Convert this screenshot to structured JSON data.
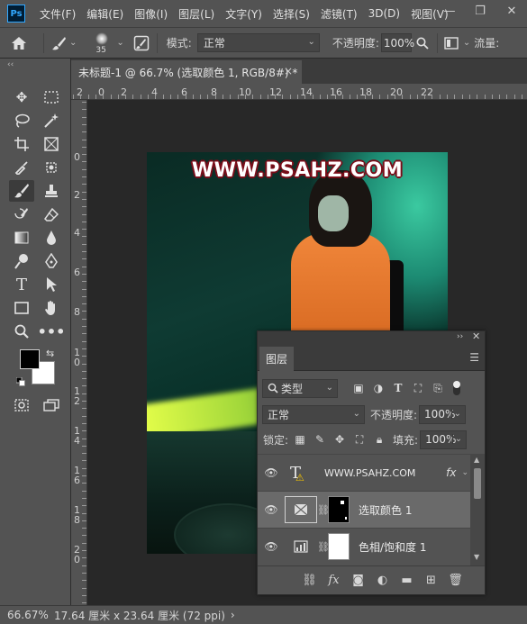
{
  "app": {
    "logo": "Ps"
  },
  "menu": [
    "文件(F)",
    "编辑(E)",
    "图像(I)",
    "图层(L)",
    "文字(Y)",
    "选择(S)",
    "滤镜(T)",
    "3D(D)",
    "视图(V)"
  ],
  "window_controls": {
    "minimize": "—",
    "restore": "❐",
    "close": "✕"
  },
  "options": {
    "brush_size": "35",
    "mode_label": "模式:",
    "mode_value": "正常",
    "opacity_label": "不透明度:",
    "opacity_value": "100%",
    "flow_label": "流量:"
  },
  "document_tab": {
    "title": "未标题-1 @ 66.7% (选取颜色 1, RGB/8#) *",
    "close": "×"
  },
  "ruler_top": [
    "2",
    "0",
    "2",
    "4",
    "6",
    "8",
    "10",
    "12",
    "14",
    "16",
    "18",
    "20",
    "22"
  ],
  "ruler_left": [
    "0",
    "2",
    "4",
    "6",
    "8",
    "1\n0",
    "1\n2",
    "1\n4",
    "1\n6",
    "1\n8",
    "2\n0"
  ],
  "canvas": {
    "watermark": "WWW.PSAHZ.COM"
  },
  "status": {
    "zoom": "66.67%",
    "doc_size": "17.64 厘米 x 23.64 厘米 (72 ppi)",
    "arrow": "›"
  },
  "layers_panel": {
    "tab_label": "图层",
    "filter_type": "类型",
    "blend_mode": "正常",
    "opacity_label": "不透明度:",
    "opacity_value": "100%",
    "lock_label": "锁定:",
    "fill_label": "填充:",
    "fill_value": "100%",
    "layers": [
      {
        "name": "WWW.PSAHZ.COM",
        "kind": "text",
        "fx": "fx"
      },
      {
        "name": "选取颜色  1",
        "kind": "selective-color",
        "selected": true
      },
      {
        "name": "色相/饱和度  1",
        "kind": "hue-saturation"
      }
    ]
  },
  "colors": {
    "accent": "#31a8ff",
    "panel_bg": "#535353",
    "canvas_bg": "#282828",
    "selected_layer": "#6a6a6a",
    "watermark_outline": "#7a0d19"
  }
}
